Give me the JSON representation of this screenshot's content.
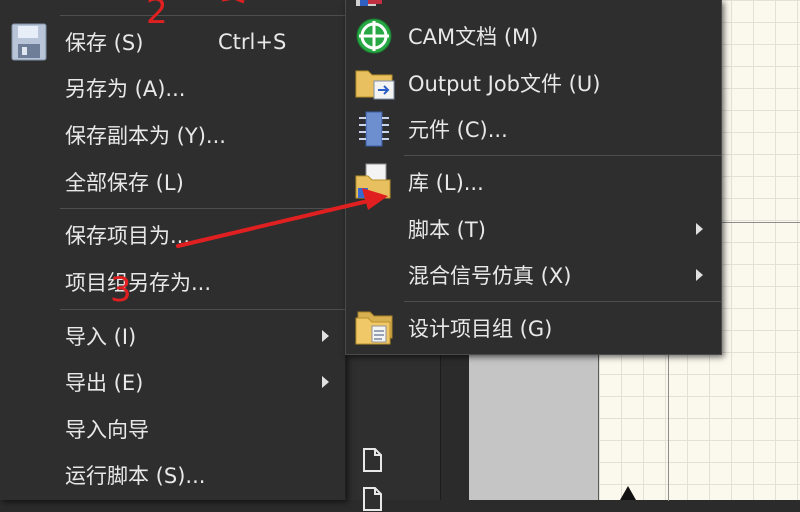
{
  "main_menu": {
    "items": [
      {
        "label": "保存 (S)",
        "shortcut": "Ctrl+S"
      },
      {
        "label": "另存为 (A)..."
      },
      {
        "label": "保存副本为 (Y)..."
      },
      {
        "label": "全部保存 (L)"
      },
      {
        "label": "保存项目为..."
      },
      {
        "label": "项目组另存为..."
      },
      {
        "label": "导入 (I)"
      },
      {
        "label": "导出 (E)"
      },
      {
        "label": "导入向导"
      },
      {
        "label": "运行脚本 (S)..."
      }
    ]
  },
  "submenu": {
    "items": [
      {
        "label": "CAM文档 (M)"
      },
      {
        "label": "Output Job文件 (U)"
      },
      {
        "label": "元件 (C)..."
      },
      {
        "label": "库 (L)..."
      },
      {
        "label": "脚本 (T)"
      },
      {
        "label": "混合信号仿真 (X)"
      },
      {
        "label": "设计项目组 (G)"
      }
    ]
  },
  "annotations": {
    "step2": "2",
    "step3": "3"
  },
  "colors": {
    "menu_bg": "#2e2e2e",
    "annotation": "#e02020",
    "canvas": "#fbf8ee"
  },
  "icons": {
    "save": "floppy-disk-icon",
    "cam": "cam-crosshair-icon",
    "output_job": "output-job-folder-icon",
    "component": "component-chip-icon",
    "library": "library-folder-icon",
    "project_group": "project-group-folder-icon"
  }
}
